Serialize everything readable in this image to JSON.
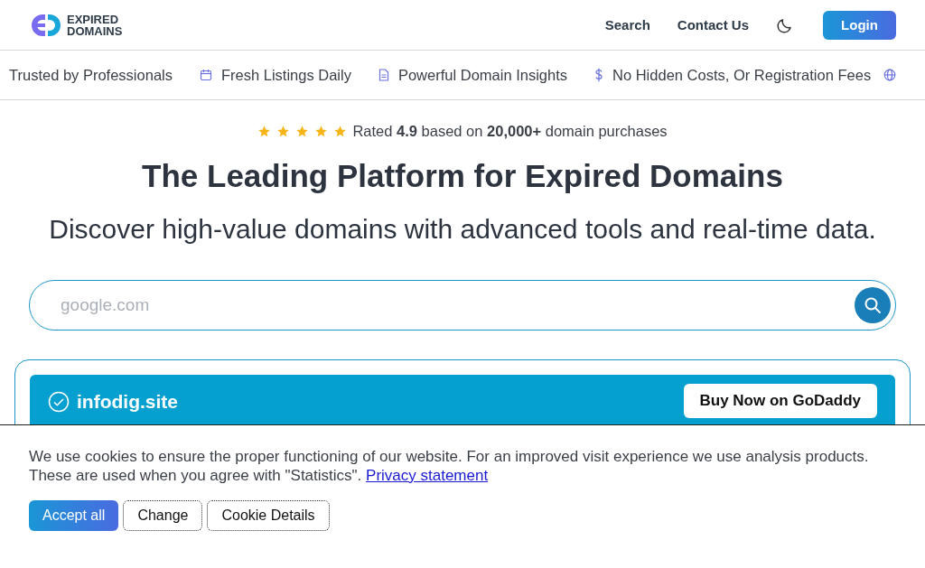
{
  "header": {
    "logo": {
      "line1": "EXPIRED",
      "line2": "DOMAINS"
    },
    "nav": [
      {
        "label": "Search"
      },
      {
        "label": "Contact Us"
      }
    ],
    "login": "Login"
  },
  "features": [
    {
      "kind": "plain",
      "label": "Trusted by Professionals"
    },
    {
      "kind": "calendar",
      "label": "Fresh Listings Daily"
    },
    {
      "kind": "document",
      "label": "Powerful Domain Insights"
    },
    {
      "kind": "dollar",
      "label": "No Hidden Costs, Or Registration Fees"
    },
    {
      "kind": "globe"
    }
  ],
  "hero": {
    "rating": {
      "stars": 5,
      "text": "Rated **4.9** based on **20,000+** domain purchases"
    },
    "title": "The Leading Platform for Expired Domains",
    "subtitle": "Discover high-value domains with advanced tools and real-time data.",
    "search": {
      "placeholder": "google.com"
    }
  },
  "featured": {
    "domain": "infodig.site",
    "verified": true,
    "button": "Buy Now on GoDaddy"
  },
  "cookie": {
    "text": "We use cookies to ensure the proper functioning of our website. For an improved visit experience we use analysis products. These are used when you agree with \"Statistics\".",
    "link": "Privacy statement",
    "buttons": [
      {
        "label": "Accept all",
        "kind": "primary"
      },
      {
        "label": "Change",
        "kind": "outline"
      },
      {
        "label": "Cookie Details",
        "kind": "outline"
      }
    ]
  }
}
